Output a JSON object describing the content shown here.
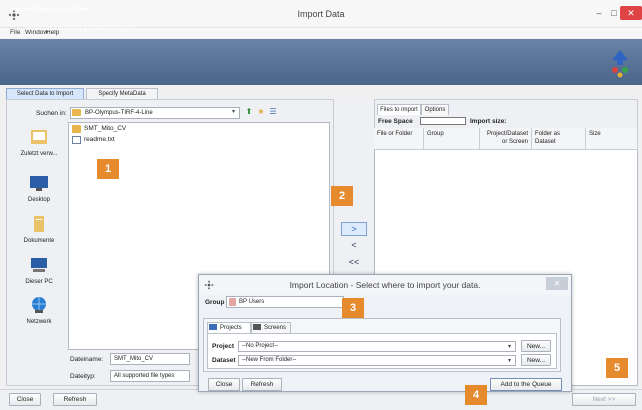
{
  "window": {
    "title": "Import Data",
    "minimize": "–",
    "maximize": "□",
    "close": "✕"
  },
  "menu": [
    "File",
    "Window",
    "Help"
  ],
  "header": {
    "title": "Import Data: Unspecified",
    "subtitle": "Select data to import and monitor imports."
  },
  "tabs": {
    "select": "Select Data to Import",
    "metadata": "Specify MetaData"
  },
  "chooser": {
    "look_in_label": "Suchen in:",
    "look_in_value": "BP-Olympus-TIRF-4-Line",
    "places": [
      "Zuletzt verw...",
      "Desktop",
      "Dokumente",
      "Dieser PC",
      "Netzwerk"
    ],
    "files": [
      {
        "name": "SMT_Mito_CV",
        "kind": "folder"
      },
      {
        "name": "readme.txt",
        "kind": "file"
      }
    ],
    "filename_label": "Dateiname:",
    "filename_value": "SMT_Mito_CV",
    "filetype_label": "Dateityp:",
    "filetype_value": "All supported file types"
  },
  "transfer": {
    "add": ">",
    "remove": "<",
    "remove_all": "<<"
  },
  "right": {
    "tab_files": "Files to import",
    "tab_options": "Options",
    "free_space_label": "Free Space",
    "import_size_label": "Import size:",
    "columns": [
      "File or Folder",
      "Group",
      "Project/Dataset or Screen",
      "Folder as Dataset",
      "Size"
    ]
  },
  "bottom": {
    "close": "Close",
    "refresh": "Refresh",
    "next": "Next >>"
  },
  "dialog": {
    "title": "Import Location - Select where to import your data.",
    "close": "✕",
    "group_label": "Group",
    "group_value": "BP Users",
    "tab_projects": "Projects",
    "tab_screens": "Screens",
    "project_label": "Project",
    "project_value": "--No Project--",
    "dataset_label": "Dataset",
    "dataset_value": "--New From Folder--",
    "new_button": "New...",
    "close_button": "Close",
    "refresh_button": "Refresh",
    "add_queue_button": "Add to the Queue"
  },
  "callouts": [
    "1",
    "2",
    "3",
    "4",
    "5"
  ],
  "colors": {
    "header": "#5a7499",
    "callout": "#e58a2d",
    "accent_blue": "#2f64c2"
  }
}
